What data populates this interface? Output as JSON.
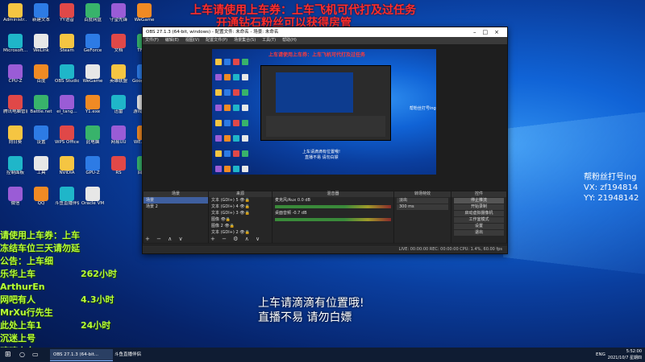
{
  "overlay": {
    "red_line1": "上车请使用上车券：上车飞机可代打及过任务",
    "red_line2": "开通钻石粉丝可以获得房管",
    "center_line1": "上车请滴滴有位置哦!",
    "center_line2": "直播不易 请勿白嫖",
    "right_line1": "帮粉丝打号ing",
    "right_line2": "VX: zf194814",
    "right_line3": "YY: 21948142",
    "green_lines": [
      "请使用上车券：上车",
      "冻结车位三天请勿延",
      "公告：上车细",
      "乐华上车",
      "ArthurEn",
      "网吧有人",
      "MrXu行先生",
      "此处上车1",
      "沉迷上号",
      "嘀嘀上车"
    ],
    "green_col2": [
      "262小时",
      "",
      "4.3小时",
      "",
      "24小时"
    ]
  },
  "desktop_icons": [
    {
      "label": "Administr..."
    },
    {
      "label": "新建文本"
    },
    {
      "label": "YY语音"
    },
    {
      "label": "百度网盘"
    },
    {
      "label": "守望先锋"
    },
    {
      "label": "WeGame"
    },
    {
      "label": "Microsoft..."
    },
    {
      "label": "WeLink"
    },
    {
      "label": "Steam"
    },
    {
      "label": "GeForce"
    },
    {
      "label": "文档"
    },
    {
      "label": "TF视频"
    },
    {
      "label": "CPU-Z"
    },
    {
      "label": "百度"
    },
    {
      "label": "OBS Studio"
    },
    {
      "label": "WeGame"
    },
    {
      "label": "英雄联盟"
    },
    {
      "label": "Google Chrome"
    },
    {
      "label": "腾讯电脑管家"
    },
    {
      "label": "Battle.net"
    },
    {
      "label": "ei_tang..."
    },
    {
      "label": "Y1.exe"
    },
    {
      "label": "迅雷"
    },
    {
      "label": "游戏加速器"
    },
    {
      "label": "向日葵"
    },
    {
      "label": "设置"
    },
    {
      "label": "WPS Office"
    },
    {
      "label": "此电脑"
    },
    {
      "label": "网易UU"
    },
    {
      "label": "WE.Reg..."
    },
    {
      "label": "控制面板"
    },
    {
      "label": "工具"
    },
    {
      "label": "NVIDIA"
    },
    {
      "label": "GPU-Z"
    },
    {
      "label": "RS"
    },
    {
      "label": "回收站"
    },
    {
      "label": "微信"
    },
    {
      "label": "QQ"
    },
    {
      "label": "斗鱼直播伴侣"
    },
    {
      "label": "Oracle VM"
    }
  ],
  "obs": {
    "title": "OBS 27.1.3 (64-bit, windows) - 配置文件: 未命名 - 场景: 未命名",
    "menu": [
      "文件(F)",
      "编辑(E)",
      "视图(V)",
      "配置文件(P)",
      "场景集合(S)",
      "工具(T)",
      "帮助(H)"
    ],
    "tabs": [
      "未选择源",
      "属性",
      "滤镜"
    ],
    "docks": {
      "scenes_title": "场景",
      "scenes": [
        "场景",
        "场景 2"
      ],
      "sources_title": "来源",
      "sources": [
        "文本 (GDI+) 5",
        "文本 (GDI+) 4",
        "文本 (GDI+) 3",
        "图像",
        "图像 2",
        "文本 (GDI+) 2"
      ],
      "mixer_title": "混音器",
      "mixer": [
        {
          "name": "麦克风/Aux",
          "db": "0.0 dB"
        },
        {
          "name": "桌面音频",
          "db": "-0.7 dB"
        }
      ],
      "transition_title": "转场特效",
      "transition_type": "淡出",
      "transition_duration": "300 ms",
      "controls_title": "控件",
      "controls": [
        "停止推流",
        "开始录制",
        "启动虚拟摄像机",
        "工作室模式",
        "设置",
        "退出"
      ]
    },
    "status": "LIVE: 00:00:00   REC: 00:00:00   CPU: 1.4%, 60.00 fps"
  },
  "preview": {
    "mini_red": "上车请使用上车券：上车飞机可代打及过任务",
    "mini_center1": "上车请滴滴有位置哦!",
    "mini_center2": "直播不易 请勿白嫖",
    "mini_right": "帮粉丝打号ing"
  },
  "taskbar": {
    "items": [
      "OBS 27.1.3 (64-bit...",
      "斗鱼直播伴侣"
    ],
    "lang": "ENG",
    "time": "5:52:00",
    "date": "2021/10/7 星期四"
  },
  "colors": {
    "banner_red": "#ff2e2e",
    "side_green": "#b7ff3a",
    "desktop_blue": "#0a3e9e"
  }
}
